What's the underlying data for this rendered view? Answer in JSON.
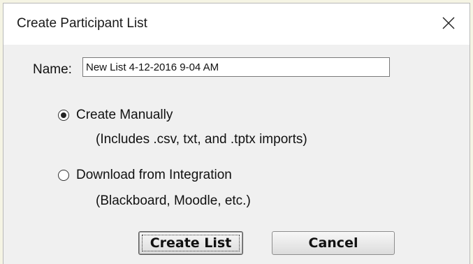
{
  "dialog": {
    "title": "Create Participant List",
    "close_icon": "close-icon"
  },
  "name_field": {
    "label": "Name:",
    "value": "New List 4-12-2016 9-04 AM"
  },
  "options": [
    {
      "label": "Create Manually",
      "sub": "(Includes .csv, txt, and .tptx imports)",
      "selected": true
    },
    {
      "label": "Download from Integration",
      "sub": "(Blackboard, Moodle, etc.)",
      "selected": false
    }
  ],
  "buttons": {
    "create": "Create List",
    "cancel": "Cancel"
  }
}
